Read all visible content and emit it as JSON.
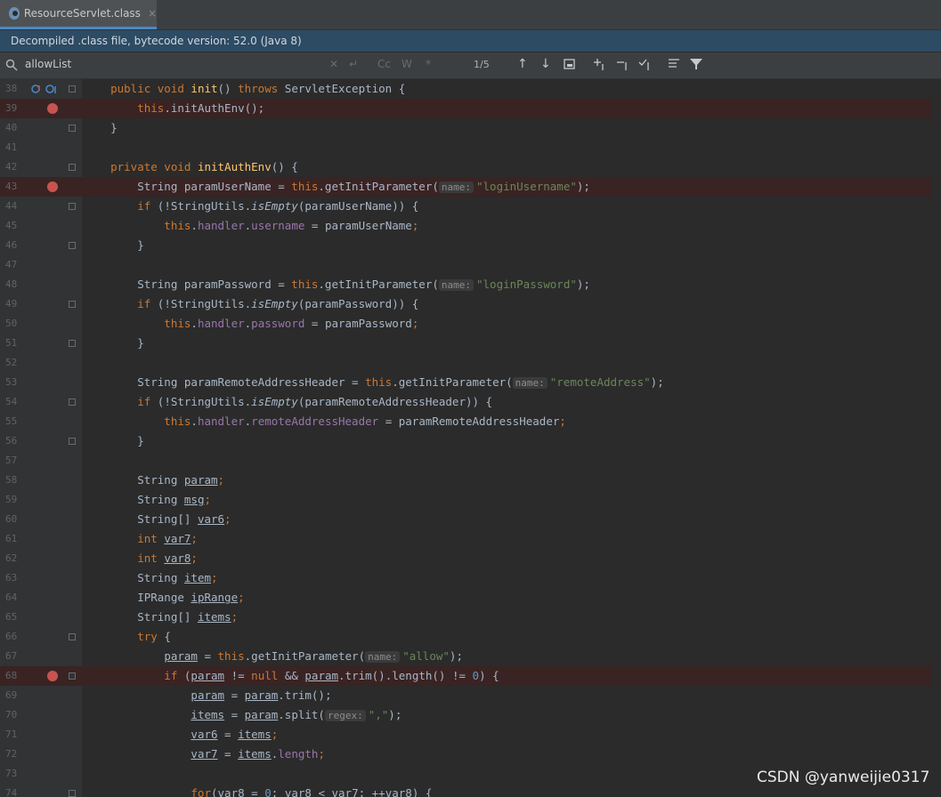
{
  "tab": {
    "label": "ResourceServlet.class",
    "close": "×"
  },
  "banner": {
    "text": "Decompiled .class file, bytecode version: 52.0 (Java 8)"
  },
  "search": {
    "query": "allowList",
    "match_case": "Cc",
    "words": "W",
    "regex": "*",
    "count": "1/5"
  },
  "lines": [
    {
      "n": "38",
      "bp": false,
      "fold": true
    },
    {
      "n": "39",
      "bp": true,
      "fold": false
    },
    {
      "n": "40",
      "bp": false,
      "fold": true
    },
    {
      "n": "41",
      "bp": false,
      "fold": false
    },
    {
      "n": "42",
      "bp": false,
      "fold": true
    },
    {
      "n": "43",
      "bp": true,
      "fold": false
    },
    {
      "n": "44",
      "bp": false,
      "fold": true
    },
    {
      "n": "45",
      "bp": false,
      "fold": false
    },
    {
      "n": "46",
      "bp": false,
      "fold": true
    },
    {
      "n": "47",
      "bp": false,
      "fold": false
    },
    {
      "n": "48",
      "bp": false,
      "fold": false
    },
    {
      "n": "49",
      "bp": false,
      "fold": true
    },
    {
      "n": "50",
      "bp": false,
      "fold": false
    },
    {
      "n": "51",
      "bp": false,
      "fold": true
    },
    {
      "n": "52",
      "bp": false,
      "fold": false
    },
    {
      "n": "53",
      "bp": false,
      "fold": false
    },
    {
      "n": "54",
      "bp": false,
      "fold": true
    },
    {
      "n": "55",
      "bp": false,
      "fold": false
    },
    {
      "n": "56",
      "bp": false,
      "fold": true
    },
    {
      "n": "57",
      "bp": false,
      "fold": false
    },
    {
      "n": "58",
      "bp": false,
      "fold": false
    },
    {
      "n": "59",
      "bp": false,
      "fold": false
    },
    {
      "n": "60",
      "bp": false,
      "fold": false
    },
    {
      "n": "61",
      "bp": false,
      "fold": false
    },
    {
      "n": "62",
      "bp": false,
      "fold": false
    },
    {
      "n": "63",
      "bp": false,
      "fold": false
    },
    {
      "n": "64",
      "bp": false,
      "fold": false
    },
    {
      "n": "65",
      "bp": false,
      "fold": false
    },
    {
      "n": "66",
      "bp": false,
      "fold": true
    },
    {
      "n": "67",
      "bp": false,
      "fold": false
    },
    {
      "n": "68",
      "bp": true,
      "fold": true
    },
    {
      "n": "69",
      "bp": false,
      "fold": false
    },
    {
      "n": "70",
      "bp": false,
      "fold": false
    },
    {
      "n": "71",
      "bp": false,
      "fold": false
    },
    {
      "n": "72",
      "bp": false,
      "fold": false
    },
    {
      "n": "73",
      "bp": false,
      "fold": false
    },
    {
      "n": "74",
      "bp": false,
      "fold": true
    }
  ],
  "code": [
    [
      [
        "kw",
        "    public void "
      ],
      [
        "fn",
        "init"
      ],
      [
        "",
        "() "
      ],
      [
        "kw",
        "throws "
      ],
      [
        "",
        "ServletException {"
      ]
    ],
    [
      [
        "kw",
        "        this"
      ],
      [
        "",
        ".initAuthEnv();"
      ]
    ],
    [
      [
        "",
        "    }"
      ]
    ],
    [
      [
        "",
        ""
      ]
    ],
    [
      [
        "kw",
        "    private void "
      ],
      [
        "fn",
        "initAuthEnv"
      ],
      [
        "",
        "() {"
      ]
    ],
    [
      [
        "",
        "        String paramUserName = "
      ],
      [
        "kw",
        "this"
      ],
      [
        "",
        ".getInitParameter("
      ],
      [
        "hint",
        "name:"
      ],
      [
        "st",
        "\"loginUsername\""
      ],
      [
        "",
        ");"
      ]
    ],
    [
      [
        "kw",
        "        if "
      ],
      [
        "",
        "(!StringUtils."
      ],
      [
        "it",
        "isEmpty"
      ],
      [
        "",
        "(paramUserName)) {"
      ]
    ],
    [
      [
        "kw",
        "            this"
      ],
      [
        "",
        "."
      ],
      [
        "fd",
        "handler"
      ],
      [
        "",
        "."
      ],
      [
        "fd",
        "username"
      ],
      [
        "",
        " = paramUserName"
      ],
      [
        "kw",
        ";"
      ]
    ],
    [
      [
        "",
        "        }"
      ]
    ],
    [
      [
        "",
        ""
      ]
    ],
    [
      [
        "",
        "        String paramPassword = "
      ],
      [
        "kw",
        "this"
      ],
      [
        "",
        ".getInitParameter("
      ],
      [
        "hint",
        "name:"
      ],
      [
        "st",
        "\"loginPassword\""
      ],
      [
        "",
        ");"
      ]
    ],
    [
      [
        "kw",
        "        if "
      ],
      [
        "",
        "(!StringUtils."
      ],
      [
        "it",
        "isEmpty"
      ],
      [
        "",
        "(paramPassword)) {"
      ]
    ],
    [
      [
        "kw",
        "            this"
      ],
      [
        "",
        "."
      ],
      [
        "fd",
        "handler"
      ],
      [
        "",
        "."
      ],
      [
        "fd",
        "password"
      ],
      [
        "",
        " = paramPassword"
      ],
      [
        "kw",
        ";"
      ]
    ],
    [
      [
        "",
        "        }"
      ]
    ],
    [
      [
        "",
        ""
      ]
    ],
    [
      [
        "",
        "        String paramRemoteAddressHeader = "
      ],
      [
        "kw",
        "this"
      ],
      [
        "",
        ".getInitParameter("
      ],
      [
        "hint",
        "name:"
      ],
      [
        "st",
        "\"remoteAddress\""
      ],
      [
        "",
        ");"
      ]
    ],
    [
      [
        "kw",
        "        if "
      ],
      [
        "",
        "(!StringUtils."
      ],
      [
        "it",
        "isEmpty"
      ],
      [
        "",
        "(paramRemoteAddressHeader)) {"
      ]
    ],
    [
      [
        "kw",
        "            this"
      ],
      [
        "",
        "."
      ],
      [
        "fd",
        "handler"
      ],
      [
        "",
        "."
      ],
      [
        "fd",
        "remoteAddressHeader"
      ],
      [
        "",
        " = paramRemoteAddressHeader"
      ],
      [
        "kw",
        ";"
      ]
    ],
    [
      [
        "",
        "        }"
      ]
    ],
    [
      [
        "",
        ""
      ]
    ],
    [
      [
        "",
        "        String "
      ],
      [
        "ul",
        "param"
      ],
      [
        "kw",
        ";"
      ]
    ],
    [
      [
        "",
        "        String "
      ],
      [
        "ul",
        "msg"
      ],
      [
        "kw",
        ";"
      ]
    ],
    [
      [
        "",
        "        String[] "
      ],
      [
        "ul",
        "var6"
      ],
      [
        "kw",
        ";"
      ]
    ],
    [
      [
        "kw",
        "        int "
      ],
      [
        "ul",
        "var7"
      ],
      [
        "kw",
        ";"
      ]
    ],
    [
      [
        "kw",
        "        int "
      ],
      [
        "ul",
        "var8"
      ],
      [
        "kw",
        ";"
      ]
    ],
    [
      [
        "",
        "        String "
      ],
      [
        "ul",
        "item"
      ],
      [
        "kw",
        ";"
      ]
    ],
    [
      [
        "",
        "        IPRange "
      ],
      [
        "ul",
        "ipRange"
      ],
      [
        "kw",
        ";"
      ]
    ],
    [
      [
        "",
        "        String[] "
      ],
      [
        "ul",
        "items"
      ],
      [
        "kw",
        ";"
      ]
    ],
    [
      [
        "kw",
        "        try "
      ],
      [
        "",
        "{"
      ]
    ],
    [
      [
        "",
        "            "
      ],
      [
        "ul",
        "param"
      ],
      [
        "",
        " = "
      ],
      [
        "kw",
        "this"
      ],
      [
        "",
        ".getInitParameter("
      ],
      [
        "hint",
        "name:"
      ],
      [
        "st",
        "\"allow\""
      ],
      [
        "",
        ");"
      ]
    ],
    [
      [
        "kw",
        "            if "
      ],
      [
        "",
        "("
      ],
      [
        "ul",
        "param"
      ],
      [
        "",
        " != "
      ],
      [
        "kw",
        "null "
      ],
      [
        "",
        "&& "
      ],
      [
        "ul",
        "param"
      ],
      [
        "",
        ".trim().length() != "
      ],
      [
        "nm",
        "0"
      ],
      [
        "",
        ") {"
      ]
    ],
    [
      [
        "",
        "                "
      ],
      [
        "ul",
        "param"
      ],
      [
        "",
        " = "
      ],
      [
        "ul",
        "param"
      ],
      [
        "",
        ".trim();"
      ]
    ],
    [
      [
        "",
        "                "
      ],
      [
        "ul",
        "items"
      ],
      [
        "",
        " = "
      ],
      [
        "ul",
        "param"
      ],
      [
        "",
        ".split("
      ],
      [
        "hint",
        "regex:"
      ],
      [
        "st",
        "\",\""
      ],
      [
        "",
        ");"
      ]
    ],
    [
      [
        "",
        "                "
      ],
      [
        "ul",
        "var6"
      ],
      [
        "",
        " = "
      ],
      [
        "ul",
        "items"
      ],
      [
        "kw",
        ";"
      ]
    ],
    [
      [
        "",
        "                "
      ],
      [
        "ul",
        "var7"
      ],
      [
        "",
        " = "
      ],
      [
        "ul",
        "items"
      ],
      [
        "",
        "."
      ],
      [
        "fd",
        "length"
      ],
      [
        "kw",
        ";"
      ]
    ],
    [
      [
        "",
        ""
      ]
    ],
    [
      [
        "kw",
        "                for"
      ],
      [
        "",
        "("
      ],
      [
        "ul",
        "var8"
      ],
      [
        "",
        " = "
      ],
      [
        "nm",
        "0"
      ],
      [
        "",
        "; "
      ],
      [
        "ul",
        "var8"
      ],
      [
        "",
        " < "
      ],
      [
        "ul",
        "var7"
      ],
      [
        "",
        "; ++"
      ],
      [
        "ul",
        "var8"
      ],
      [
        "",
        ") {"
      ]
    ]
  ],
  "watermark": "CSDN @yanweijie0317"
}
